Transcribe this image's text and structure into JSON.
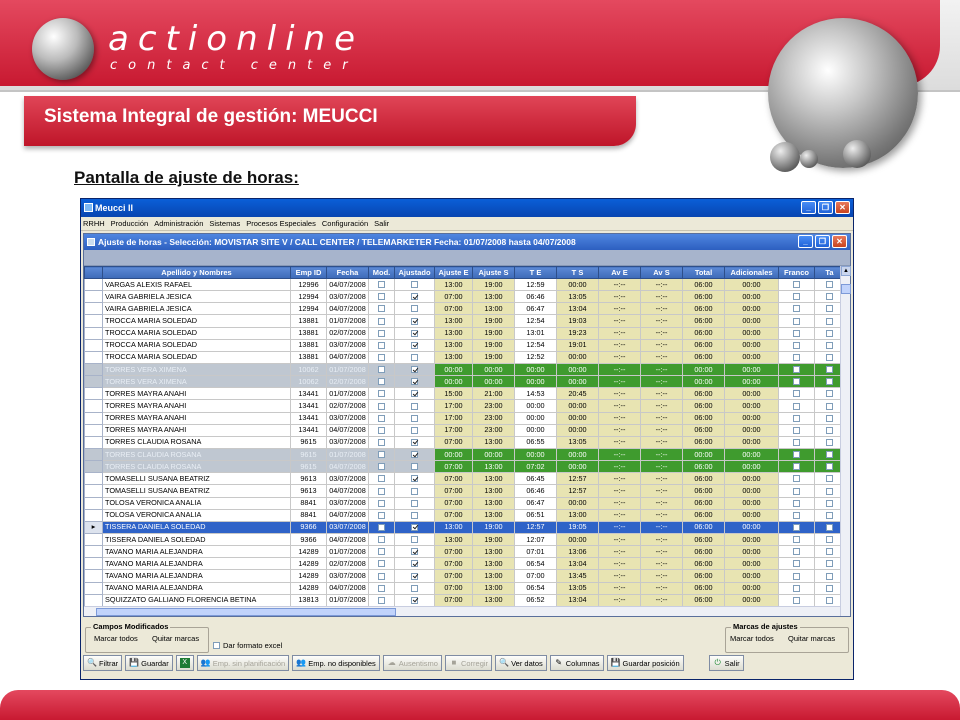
{
  "brand": {
    "line1": "actionline",
    "line2": "contact center"
  },
  "slide_title": "Sistema Integral de gestión: MEUCCI",
  "slide_subtitle": "Pantalla de ajuste de horas:",
  "app": {
    "title": "Meucci II",
    "menu": [
      "RRHH",
      "Producción",
      "Administración",
      "Sistemas",
      "Procesos Especiales",
      "Configuración",
      "Salir"
    ],
    "child_title": "Ajuste de horas - Selección: MOVISTAR SITE V / CALL CENTER / TELEMARKETER Fecha: 01/07/2008 hasta 04/07/2008",
    "columns": [
      "Apellido y Nombres",
      "Emp ID",
      "Fecha",
      "Mod.",
      "Ajustado",
      "Ajuste E",
      "Ajuste S",
      "T E",
      "T S",
      "Av E",
      "Av S",
      "Total",
      "Adicionales",
      "Franco",
      "Ta"
    ],
    "rows": [
      {
        "t": "std",
        "name": "VARGAS ALEXIS RAFAEL",
        "id": "12996",
        "fecha": "04/07/2008",
        "mod": false,
        "aj": false,
        "ae": "13:00",
        "as": "19:00",
        "te": "12:59",
        "ts": "00:00",
        "ave": "--:--",
        "avs": "--:--",
        "total": "06:00",
        "adic": "00:00"
      },
      {
        "t": "std",
        "name": "VAIRA GABRIELA JESICA",
        "id": "12994",
        "fecha": "03/07/2008",
        "mod": false,
        "aj": true,
        "ae": "07:00",
        "as": "13:00",
        "te": "06:46",
        "ts": "13:05",
        "ave": "--:--",
        "avs": "--:--",
        "total": "06:00",
        "adic": "00:00"
      },
      {
        "t": "std",
        "name": "VAIRA GABRIELA JESICA",
        "id": "12994",
        "fecha": "04/07/2008",
        "mod": false,
        "aj": false,
        "ae": "07:00",
        "as": "13:00",
        "te": "06:47",
        "ts": "13:04",
        "ave": "--:--",
        "avs": "--:--",
        "total": "06:00",
        "adic": "00:00"
      },
      {
        "t": "std",
        "name": "TROCCA MARIA SOLEDAD",
        "id": "13881",
        "fecha": "01/07/2008",
        "mod": false,
        "aj": true,
        "ae": "13:00",
        "as": "19:00",
        "te": "12:54",
        "ts": "19:03",
        "ave": "--:--",
        "avs": "--:--",
        "total": "06:00",
        "adic": "00:00"
      },
      {
        "t": "std",
        "name": "TROCCA MARIA SOLEDAD",
        "id": "13881",
        "fecha": "02/07/2008",
        "mod": false,
        "aj": true,
        "ae": "13:00",
        "as": "19:00",
        "te": "13:01",
        "ts": "19:23",
        "ave": "--:--",
        "avs": "--:--",
        "total": "06:00",
        "adic": "00:00"
      },
      {
        "t": "std",
        "name": "TROCCA MARIA SOLEDAD",
        "id": "13881",
        "fecha": "03/07/2008",
        "mod": false,
        "aj": true,
        "ae": "13:00",
        "as": "19:00",
        "te": "12:54",
        "ts": "19:01",
        "ave": "--:--",
        "avs": "--:--",
        "total": "06:00",
        "adic": "00:00"
      },
      {
        "t": "std",
        "name": "TROCCA MARIA SOLEDAD",
        "id": "13881",
        "fecha": "04/07/2008",
        "mod": false,
        "aj": false,
        "ae": "13:00",
        "as": "19:00",
        "te": "12:52",
        "ts": "00:00",
        "ave": "--:--",
        "avs": "--:--",
        "total": "06:00",
        "adic": "00:00"
      },
      {
        "t": "grey",
        "name": "TORRES VERA XIMENA",
        "id": "10062",
        "fecha": "01/07/2008",
        "mod": false,
        "aj": true,
        "ae": "00:00",
        "as": "00:00",
        "te": "00:00",
        "ts": "00:00",
        "ave": "--:--",
        "avs": "--:--",
        "total": "00:00",
        "adic": "00:00"
      },
      {
        "t": "grey",
        "name": "TORRES VERA XIMENA",
        "id": "10062",
        "fecha": "02/07/2008",
        "mod": false,
        "aj": true,
        "ae": "00:00",
        "as": "00:00",
        "te": "00:00",
        "ts": "00:00",
        "ave": "--:--",
        "avs": "--:--",
        "total": "00:00",
        "adic": "00:00"
      },
      {
        "t": "std",
        "name": "TORRES MAYRA ANAHI",
        "id": "13441",
        "fecha": "01/07/2008",
        "mod": false,
        "aj": true,
        "ae": "15:00",
        "as": "21:00",
        "te": "14:53",
        "ts": "20:45",
        "ave": "--:--",
        "avs": "--:--",
        "total": "06:00",
        "adic": "00:00"
      },
      {
        "t": "std",
        "name": "TORRES MAYRA ANAHI",
        "id": "13441",
        "fecha": "02/07/2008",
        "mod": false,
        "aj": false,
        "ae": "17:00",
        "as": "23:00",
        "te": "00:00",
        "ts": "00:00",
        "ave": "--:--",
        "avs": "--:--",
        "total": "06:00",
        "adic": "00:00"
      },
      {
        "t": "std",
        "name": "TORRES MAYRA ANAHI",
        "id": "13441",
        "fecha": "03/07/2008",
        "mod": false,
        "aj": false,
        "ae": "17:00",
        "as": "23:00",
        "te": "00:00",
        "ts": "00:00",
        "ave": "--:--",
        "avs": "--:--",
        "total": "06:00",
        "adic": "00:00"
      },
      {
        "t": "std",
        "name": "TORRES MAYRA ANAHI",
        "id": "13441",
        "fecha": "04/07/2008",
        "mod": false,
        "aj": false,
        "ae": "17:00",
        "as": "23:00",
        "te": "00:00",
        "ts": "00:00",
        "ave": "--:--",
        "avs": "--:--",
        "total": "06:00",
        "adic": "00:00"
      },
      {
        "t": "std",
        "name": "TORRES CLAUDIA ROSANA",
        "id": "9615",
        "fecha": "03/07/2008",
        "mod": false,
        "aj": true,
        "ae": "07:00",
        "as": "13:00",
        "te": "06:55",
        "ts": "13:05",
        "ave": "--:--",
        "avs": "--:--",
        "total": "06:00",
        "adic": "00:00"
      },
      {
        "t": "grey",
        "name": "TORRES CLAUDIA ROSANA",
        "id": "9615",
        "fecha": "01/07/2008",
        "mod": false,
        "aj": true,
        "ae": "00:00",
        "as": "00:00",
        "te": "00:00",
        "ts": "00:00",
        "ave": "--:--",
        "avs": "--:--",
        "total": "00:00",
        "adic": "00:00"
      },
      {
        "t": "grey",
        "name": "TORRES CLAUDIA ROSANA",
        "id": "9615",
        "fecha": "04/07/2008",
        "mod": false,
        "aj": false,
        "ae": "07:00",
        "as": "13:00",
        "te": "07:02",
        "ts": "00:00",
        "ave": "--:--",
        "avs": "--:--",
        "total": "06:00",
        "adic": "00:00"
      },
      {
        "t": "std",
        "name": "TOMASELLI SUSANA BEATRIZ",
        "id": "9613",
        "fecha": "03/07/2008",
        "mod": false,
        "aj": true,
        "ae": "07:00",
        "as": "13:00",
        "te": "06:45",
        "ts": "12:57",
        "ave": "--:--",
        "avs": "--:--",
        "total": "06:00",
        "adic": "00:00"
      },
      {
        "t": "std",
        "name": "TOMASELLI SUSANA BEATRIZ",
        "id": "9613",
        "fecha": "04/07/2008",
        "mod": false,
        "aj": false,
        "ae": "07:00",
        "as": "13:00",
        "te": "06:46",
        "ts": "12:57",
        "ave": "--:--",
        "avs": "--:--",
        "total": "06:00",
        "adic": "00:00"
      },
      {
        "t": "std",
        "name": "TOLOSA VERONICA ANALIA",
        "id": "8841",
        "fecha": "03/07/2008",
        "mod": false,
        "aj": false,
        "ae": "07:00",
        "as": "13:00",
        "te": "06:47",
        "ts": "00:00",
        "ave": "--:--",
        "avs": "--:--",
        "total": "06:00",
        "adic": "00:00"
      },
      {
        "t": "std",
        "name": "TOLOSA VERONICA ANALIA",
        "id": "8841",
        "fecha": "04/07/2008",
        "mod": false,
        "aj": false,
        "ae": "07:00",
        "as": "13:00",
        "te": "06:51",
        "ts": "13:00",
        "ave": "--:--",
        "avs": "--:--",
        "total": "06:00",
        "adic": "00:00"
      },
      {
        "t": "sel",
        "name": "TISSERA DANIELA SOLEDAD",
        "id": "9366",
        "fecha": "03/07/2008",
        "mod": false,
        "aj": true,
        "ae": "13:00",
        "as": "19:00",
        "te": "12:57",
        "ts": "19:05",
        "ave": "--:--",
        "avs": "--:--",
        "total": "06:00",
        "adic": "00:00"
      },
      {
        "t": "std",
        "name": "TISSERA DANIELA SOLEDAD",
        "id": "9366",
        "fecha": "04/07/2008",
        "mod": false,
        "aj": false,
        "ae": "13:00",
        "as": "19:00",
        "te": "12:07",
        "ts": "00:00",
        "ave": "--:--",
        "avs": "--:--",
        "total": "06:00",
        "adic": "00:00"
      },
      {
        "t": "std",
        "name": "TAVANO MARIA ALEJANDRA",
        "id": "14289",
        "fecha": "01/07/2008",
        "mod": false,
        "aj": true,
        "ae": "07:00",
        "as": "13:00",
        "te": "07:01",
        "ts": "13:06",
        "ave": "--:--",
        "avs": "--:--",
        "total": "06:00",
        "adic": "00:00"
      },
      {
        "t": "std",
        "name": "TAVANO MARIA ALEJANDRA",
        "id": "14289",
        "fecha": "02/07/2008",
        "mod": false,
        "aj": true,
        "ae": "07:00",
        "as": "13:00",
        "te": "06:54",
        "ts": "13:04",
        "ave": "--:--",
        "avs": "--:--",
        "total": "06:00",
        "adic": "00:00"
      },
      {
        "t": "std",
        "name": "TAVANO MARIA ALEJANDRA",
        "id": "14289",
        "fecha": "03/07/2008",
        "mod": false,
        "aj": true,
        "ae": "07:00",
        "as": "13:00",
        "te": "07:00",
        "ts": "13:45",
        "ave": "--:--",
        "avs": "--:--",
        "total": "06:00",
        "adic": "00:00"
      },
      {
        "t": "std",
        "name": "TAVANO MARIA ALEJANDRA",
        "id": "14289",
        "fecha": "04/07/2008",
        "mod": false,
        "aj": false,
        "ae": "07:00",
        "as": "13:00",
        "te": "06:54",
        "ts": "13:05",
        "ave": "--:--",
        "avs": "--:--",
        "total": "06:00",
        "adic": "00:00"
      },
      {
        "t": "std",
        "name": "SQUIZZATO GALLIANO FLORENCIA BETINA",
        "id": "13813",
        "fecha": "01/07/2008",
        "mod": false,
        "aj": true,
        "ae": "07:00",
        "as": "13:00",
        "te": "06:52",
        "ts": "13:04",
        "ave": "--:--",
        "avs": "--:--",
        "total": "06:00",
        "adic": "00:00"
      }
    ],
    "campos": {
      "title": "Campos Modificados",
      "marcar": "Marcar todos",
      "quitar": "Quitar marcas"
    },
    "marcas": {
      "title": "Marcas de ajustes",
      "marcar": "Marcar todos",
      "quitar": "Quitar marcas"
    },
    "dar_formato": "Dar formato excel",
    "buttons": {
      "filtrar": "Filtrar",
      "guardar": "Guardar",
      "emp_sin": "Emp. sin planificación",
      "emp_no": "Emp. no disponibles",
      "ausentismo": "Ausentismo",
      "corregir": "Corregir",
      "ver_datos": "Ver datos",
      "columnas": "Columnas",
      "guardar_pos": "Guardar posición",
      "salir": "Salir"
    }
  },
  "colors": {
    "brand_red": "#c81931",
    "grid_header": "#3d6ab8",
    "selected_row": "#2f63c8",
    "highlight_green": "#3f9b2e",
    "adjust_cell": "#e8e4b2"
  }
}
